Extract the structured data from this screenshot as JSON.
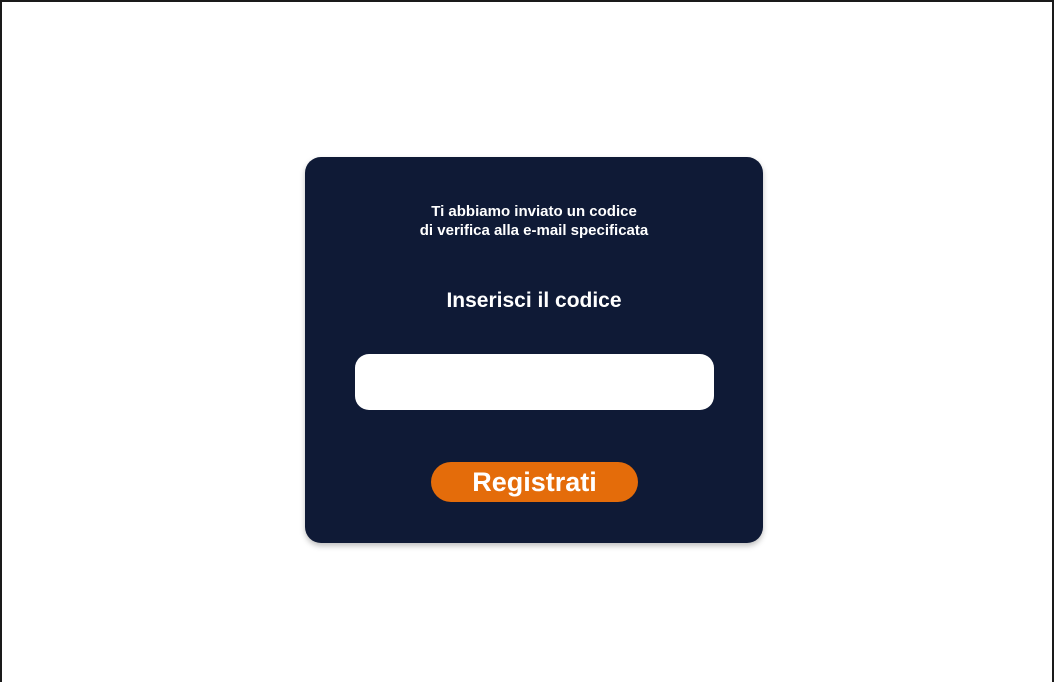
{
  "verification_card": {
    "message_line_1": "Ti abbiamo inviato un codice",
    "message_line_2": "di verifica alla e-mail specificata",
    "prompt": "Inserisci il codice",
    "code_input": {
      "value": "",
      "placeholder": ""
    },
    "submit_label": "Registrati"
  },
  "colors": {
    "card_background": "#0f1a36",
    "button_accent": "#e46c0a",
    "text": "#ffffff"
  }
}
